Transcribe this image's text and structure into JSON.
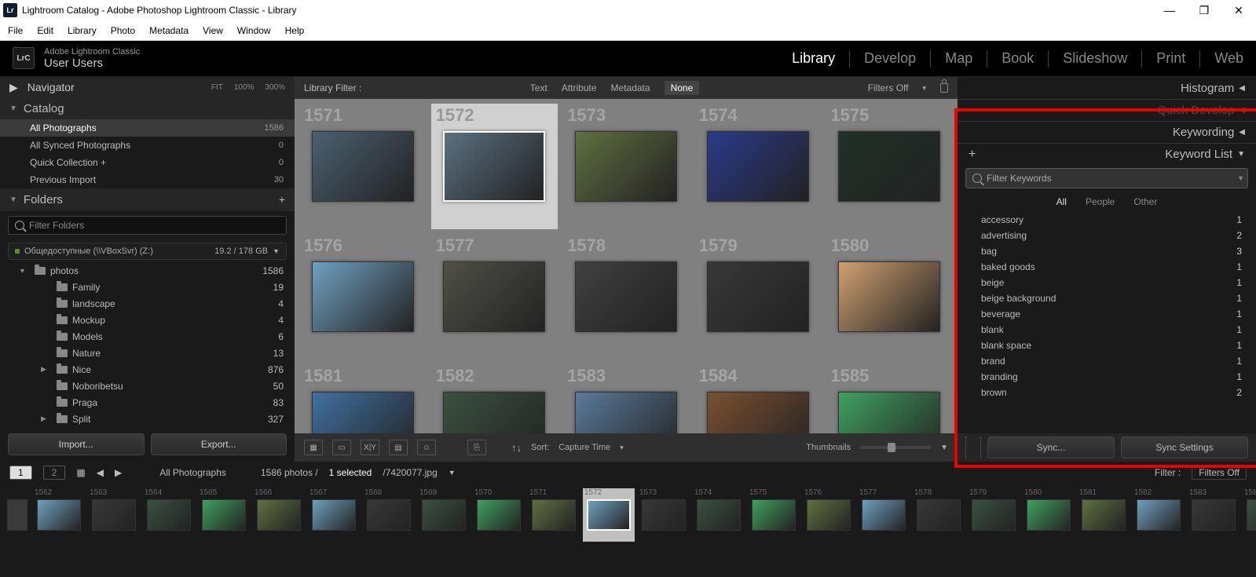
{
  "window": {
    "title": "Lightroom Catalog - Adobe Photoshop Lightroom Classic - Library",
    "app_icon_text": "Lr"
  },
  "menu": [
    "File",
    "Edit",
    "Library",
    "Photo",
    "Metadata",
    "View",
    "Window",
    "Help"
  ],
  "brand": {
    "icon": "LrC",
    "subtitle": "Adobe Lightroom Classic",
    "user": "User Users"
  },
  "modules": [
    "Library",
    "Develop",
    "Map",
    "Book",
    "Slideshow",
    "Print",
    "Web"
  ],
  "active_module": "Library",
  "navigator": {
    "label": "Navigator",
    "opts": [
      "FIT",
      "100%",
      "300%"
    ]
  },
  "catalog": {
    "label": "Catalog",
    "items": [
      {
        "label": "All Photographs",
        "count": "1586",
        "sel": true
      },
      {
        "label": "All Synced Photographs",
        "count": "0"
      },
      {
        "label": "Quick Collection +",
        "count": "0"
      },
      {
        "label": "Previous Import",
        "count": "30"
      }
    ]
  },
  "folders": {
    "label": "Folders",
    "filter_placeholder": "Filter Folders",
    "volume": {
      "name": "Общедоступные (\\\\VBoxSvr) (Z:)",
      "usage": "19.2 / 178 GB"
    },
    "root": {
      "label": "photos",
      "count": "1586"
    },
    "items": [
      {
        "label": "Family",
        "count": "19"
      },
      {
        "label": "landscape",
        "count": "4"
      },
      {
        "label": "Mockup",
        "count": "4"
      },
      {
        "label": "Models",
        "count": "6"
      },
      {
        "label": "Nature",
        "count": "13"
      },
      {
        "label": "Nice",
        "count": "876",
        "expand": true
      },
      {
        "label": "Noboribetsu",
        "count": "50"
      },
      {
        "label": "Praga",
        "count": "83"
      },
      {
        "label": "Split",
        "count": "327",
        "expand": true
      }
    ]
  },
  "left_buttons": {
    "import": "Import...",
    "export": "Export..."
  },
  "library_filter": {
    "label": "Library Filter :",
    "opts": [
      "Text",
      "Attribute",
      "Metadata",
      "None"
    ],
    "selected": "None",
    "right": "Filters Off"
  },
  "grid_start": 1571,
  "grid_selected": 1572,
  "center_toolbar": {
    "sort_label": "Sort:",
    "sort_value": "Capture Time",
    "thumb_label": "Thumbnails"
  },
  "right": {
    "histogram": "Histogram",
    "quick_develop": "Quick Develop",
    "keywording": "Keywording",
    "keyword_list": "Keyword List",
    "filter_placeholder": "Filter Keywords",
    "tabs": [
      "All",
      "People",
      "Other"
    ],
    "active_tab": "All",
    "keywords": [
      {
        "label": "accessory",
        "count": "1"
      },
      {
        "label": "advertising",
        "count": "2"
      },
      {
        "label": "bag",
        "count": "3"
      },
      {
        "label": "baked goods",
        "count": "1"
      },
      {
        "label": "beige",
        "count": "1"
      },
      {
        "label": "beige background",
        "count": "1"
      },
      {
        "label": "beverage",
        "count": "1"
      },
      {
        "label": "blank",
        "count": "1"
      },
      {
        "label": "blank space",
        "count": "1"
      },
      {
        "label": "brand",
        "count": "1"
      },
      {
        "label": "branding",
        "count": "1"
      },
      {
        "label": "brown",
        "count": "2"
      }
    ],
    "sync": "Sync...",
    "sync_settings": "Sync Settings"
  },
  "status": {
    "page1": "1",
    "page2": "2",
    "breadcrumb": "All Photographs",
    "countline": "1586 photos /",
    "selection": "1 selected",
    "filename": "/7420077.jpg",
    "filter_label": "Filter :",
    "filter_value": "Filters Off"
  },
  "filmstrip_start": 1562,
  "filmstrip_selected": 1572
}
